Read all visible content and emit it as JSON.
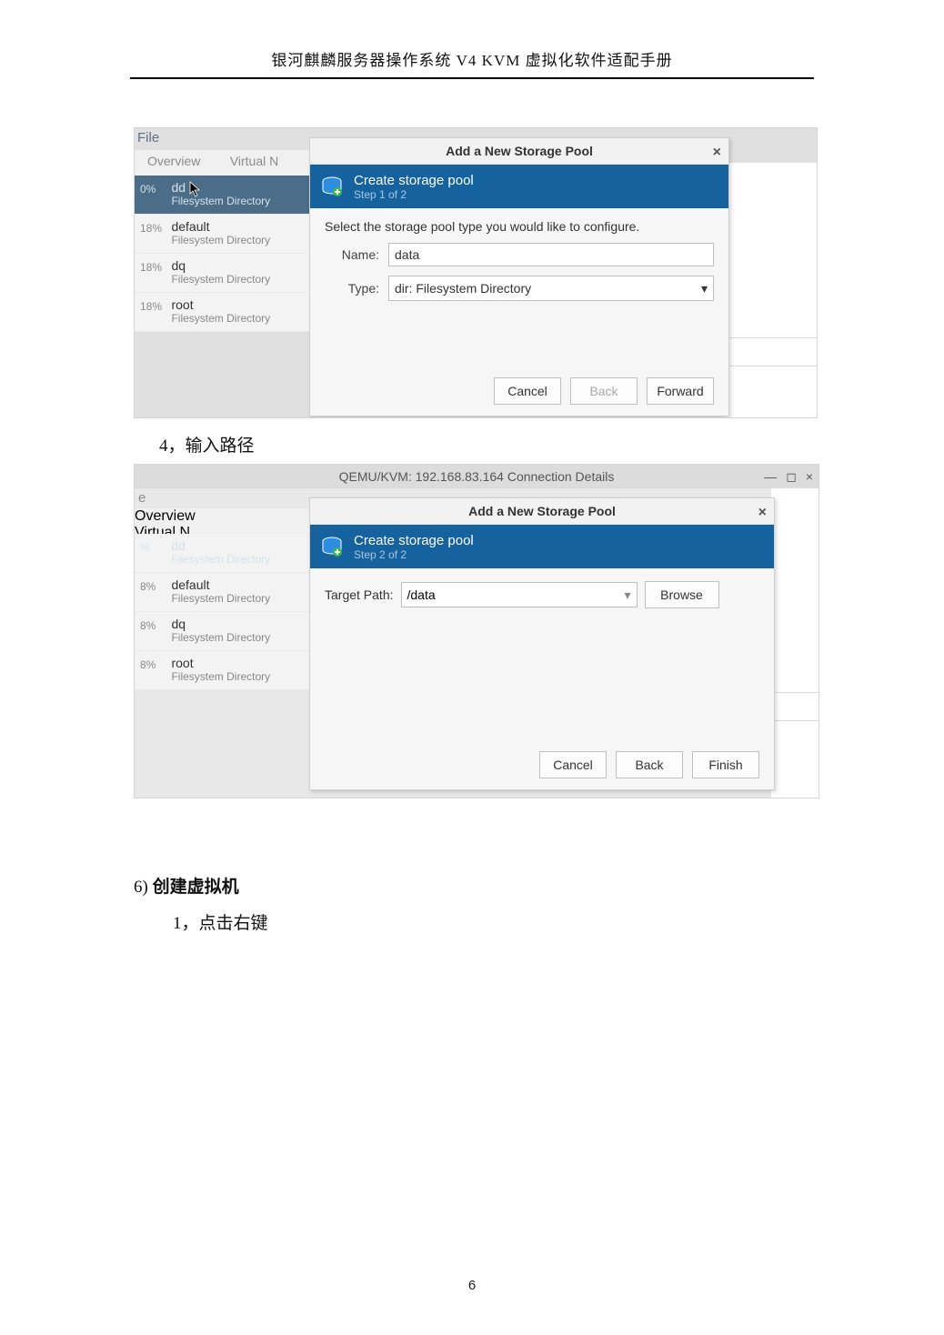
{
  "doc": {
    "header": "银河麒麟服务器操作系统 V4 KVM 虚拟化软件适配手册",
    "step4": "4，输入路径",
    "sec6_num": "6)",
    "sec6_title": "创建虚拟机",
    "sec6_step1": "1，点击右键",
    "page_number": "6"
  },
  "shot1": {
    "menu_file": "File",
    "tab_overview": "Overview",
    "tab_virtualn": "Virtual N",
    "sidebar": [
      {
        "pct": "0%",
        "name": "dd",
        "sub": "Filesystem Directory",
        "active": true
      },
      {
        "pct": "18%",
        "name": "default",
        "sub": "Filesystem Directory",
        "active": false
      },
      {
        "pct": "18%",
        "name": "dq",
        "sub": "Filesystem Directory",
        "active": false
      },
      {
        "pct": "18%",
        "name": "root",
        "sub": "Filesystem Directory",
        "active": false
      }
    ],
    "dialog": {
      "title": "Add a New Storage Pool",
      "banner1": "Create storage pool",
      "banner2": "Step 1 of 2",
      "desc": "Select the storage pool type you would like to configure.",
      "name_label": "Name:",
      "name_value": "data",
      "type_label": "Type:",
      "type_value": "dir: Filesystem Directory",
      "btn_cancel": "Cancel",
      "btn_back": "Back",
      "btn_forward": "Forward"
    }
  },
  "shot2": {
    "window_title": "QEMU/KVM: 192.168.83.164 Connection Details",
    "menu_e": "e",
    "tab_overview": "Overview",
    "tab_virtualn": "Virtual N",
    "sidebar": [
      {
        "pct": "%",
        "name": "dd",
        "sub": "Filesystem Directory",
        "active": true
      },
      {
        "pct": "8%",
        "name": "default",
        "sub": "Filesystem Directory",
        "active": false
      },
      {
        "pct": "8%",
        "name": "dq",
        "sub": "Filesystem Directory",
        "active": false
      },
      {
        "pct": "8%",
        "name": "root",
        "sub": "Filesystem Directory",
        "active": false
      }
    ],
    "dialog": {
      "title": "Add a New Storage Pool",
      "banner1": "Create storage pool",
      "banner2": "Step 2 of 2",
      "target_label": "Target Path:",
      "target_value": "/data",
      "btn_browse": "Browse",
      "btn_cancel": "Cancel",
      "btn_back": "Back",
      "btn_finish": "Finish"
    }
  }
}
